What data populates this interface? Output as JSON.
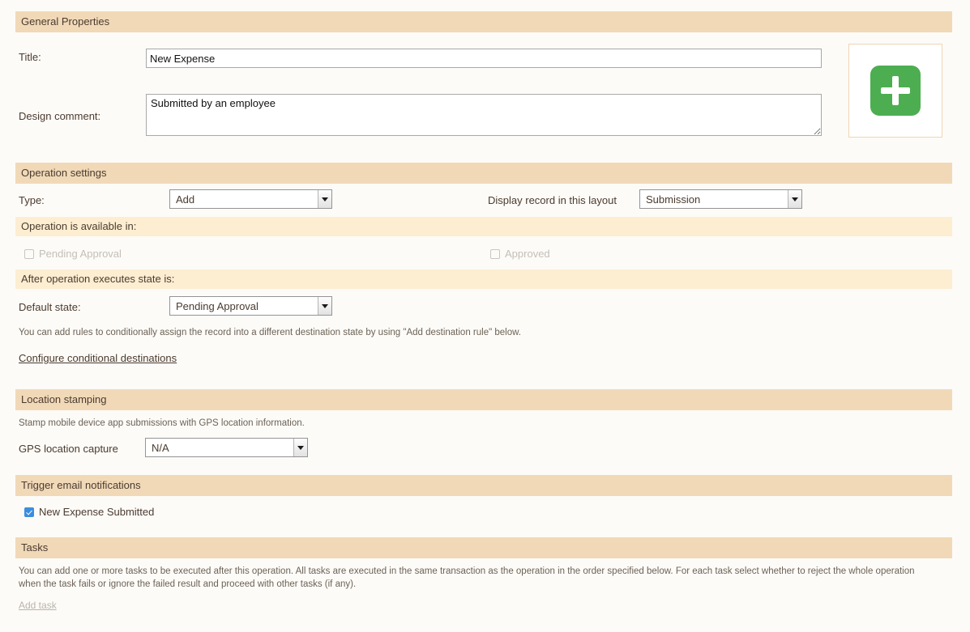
{
  "sections": {
    "general_properties": {
      "header": "General Properties",
      "title_label": "Title:",
      "title_value": "New Expense",
      "title_placeholder": "",
      "design_comment_label": "Design comment:",
      "design_comment_value": "Submitted by an employee",
      "design_comment_placeholder": "",
      "add_icon_name": "plus-icon"
    },
    "operation_settings": {
      "header": "Operation settings",
      "type_label": "Type:",
      "type_value": "Add",
      "display_record_label": "Display record in this layout",
      "display_record_value": "Submission",
      "available_in_header": "Operation is available in:",
      "available_in_options": [
        {
          "label": "Pending Approval",
          "checked": false,
          "disabled": true
        },
        {
          "label": "Approved",
          "checked": false,
          "disabled": true
        }
      ],
      "after_executes_header": "After operation executes state is:",
      "default_state_label": "Default state:",
      "default_state_value": "Pending Approval",
      "rules_help": "You can add rules to conditionally assign the record into a different destination state by using \"Add destination rule\" below.",
      "configure_link": "Configure conditional destinations"
    },
    "location_stamping": {
      "header": "Location stamping",
      "help": "Stamp mobile device app submissions with GPS location information.",
      "gps_label": "GPS location capture",
      "gps_value": "N/A"
    },
    "trigger_email": {
      "header": "Trigger email notifications",
      "notifications": [
        {
          "label": "New Expense Submitted",
          "checked": true
        }
      ]
    },
    "tasks": {
      "header": "Tasks",
      "help": "You can add one or more tasks to be executed after this operation. All tasks are executed in the same transaction as the operation in the order specified below. For each task select whether to reject the whole operation when the task fails or ignore the failed result and proceed with other tasks (if any).",
      "add_task_link": "Add task"
    }
  },
  "colors": {
    "page_background": "#fdfbf7",
    "section_header_background": "#f1d9b8",
    "sub_header_background": "#fdeed2",
    "text": "#4a3b30",
    "accent_green": "#4cae50",
    "checkbox_blue": "#3b8ede"
  }
}
